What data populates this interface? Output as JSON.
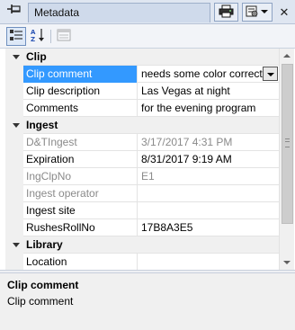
{
  "panel": {
    "tab_title": "Metadata",
    "pin_icon": "pin-icon",
    "print_icon": "printer-icon",
    "properties_icon": "properties-menu-icon",
    "close_icon": "close-icon"
  },
  "toolbar": {
    "categorized_icon": "categorized-view-icon",
    "alphabetical_icon": "sort-az-icon",
    "property_pages_icon": "property-pages-icon"
  },
  "grid": {
    "rows": [
      {
        "kind": "category",
        "name": "Clip"
      },
      {
        "kind": "property",
        "name": "Clip comment",
        "value": "needs some color correction",
        "selected": true,
        "readonly": false,
        "dropdown": true
      },
      {
        "kind": "property",
        "name": "Clip description",
        "value": "Las Vegas at night",
        "selected": false,
        "readonly": false
      },
      {
        "kind": "property",
        "name": "Comments",
        "value": "for the evening program",
        "selected": false,
        "readonly": false
      },
      {
        "kind": "category",
        "name": "Ingest"
      },
      {
        "kind": "property",
        "name": "D&TIngest",
        "value": "3/17/2017 4:31 PM",
        "selected": false,
        "readonly": true
      },
      {
        "kind": "property",
        "name": "Expiration",
        "value": "8/31/2017 9:19 AM",
        "selected": false,
        "readonly": false
      },
      {
        "kind": "property",
        "name": "IngClpNo",
        "value": "E1",
        "selected": false,
        "readonly": true
      },
      {
        "kind": "property",
        "name": "Ingest operator",
        "value": "",
        "selected": false,
        "readonly": true
      },
      {
        "kind": "property",
        "name": "Ingest site",
        "value": "",
        "selected": false,
        "readonly": false
      },
      {
        "kind": "property",
        "name": "RushesRollNo",
        "value": "17B8A3E5",
        "selected": false,
        "readonly": false
      },
      {
        "kind": "category",
        "name": "Library"
      },
      {
        "kind": "property",
        "name": "Location",
        "value": "",
        "selected": false,
        "readonly": false
      }
    ]
  },
  "description": {
    "title": "Clip comment",
    "text": "Clip comment"
  },
  "colors": {
    "selection": "#3399ff",
    "readonly_text": "#8a8a8a",
    "tab_background": "#cfdaeb"
  }
}
